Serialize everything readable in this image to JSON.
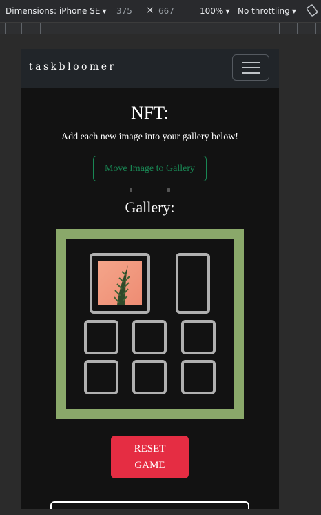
{
  "devtools": {
    "dimensions_label": "Dimensions: iPhone SE",
    "width": "375",
    "height": "667",
    "separator": "×",
    "zoom": "100%",
    "throttling": "No throttling"
  },
  "navbar": {
    "brand": "taskbloomer"
  },
  "main": {
    "title": "NFT:",
    "subtitle": "Add each new image into your gallery below!",
    "move_button": "Move Image to Gallery",
    "gallery_title": "Gallery:",
    "reset_button": "RESET GAME"
  },
  "colors": {
    "page_bg": "#121212",
    "navbar_bg": "#212529",
    "gallery_frame": "#8aa86a",
    "move_button": "#198754",
    "reset_button": "#e52d43",
    "slot_border": "#b0b0b0"
  }
}
